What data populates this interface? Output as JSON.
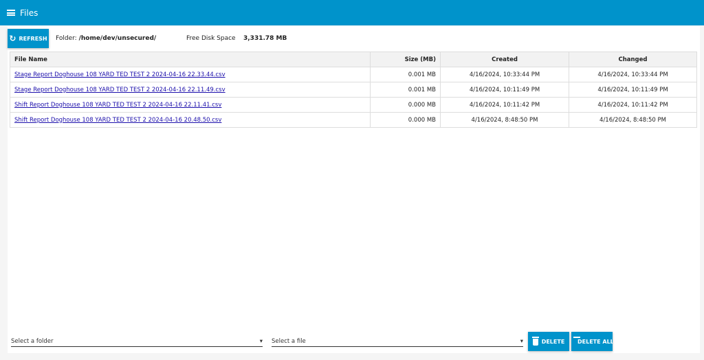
{
  "header": {
    "title": "Files"
  },
  "toolbar": {
    "refresh_label": "REFRESH",
    "folder_label": "Folder:",
    "folder_path": "/home/dev/unsecured/",
    "free_label": "Free Disk Space",
    "free_value": "3,331.78 MB"
  },
  "table": {
    "columns": [
      "File Name",
      "Size (MB)",
      "Created",
      "Changed"
    ],
    "rows": [
      [
        "Stage Report Doghouse 108 YARD TED TEST 2 2024-04-16 22.33.44.csv",
        "0.001 MB",
        "4/16/2024, 10:33:44 PM",
        "4/16/2024, 10:33:44 PM"
      ],
      [
        "Stage Report Doghouse 108 YARD TED TEST 2 2024-04-16 22.11.49.csv",
        "0.001 MB",
        "4/16/2024, 10:11:49 PM",
        "4/16/2024, 10:11:49 PM"
      ],
      [
        "Shift Report Doghouse 108 YARD TED TEST 2 2024-04-16 22.11.41.csv",
        "0.000 MB",
        "4/16/2024, 10:11:42 PM",
        "4/16/2024, 10:11:42 PM"
      ],
      [
        "Shift Report Doghouse 108 YARD TED TEST 2 2024-04-16 20.48.50.csv",
        "0.000 MB",
        "4/16/2024, 8:48:50 PM",
        "4/16/2024, 8:48:50 PM"
      ]
    ]
  },
  "footer": {
    "folder_select": "Select a folder",
    "file_select": "Select a file",
    "delete_label": "DELETE",
    "delete_all_label": "DELETE ALL"
  },
  "colors": {
    "accent": "#0093cb"
  }
}
